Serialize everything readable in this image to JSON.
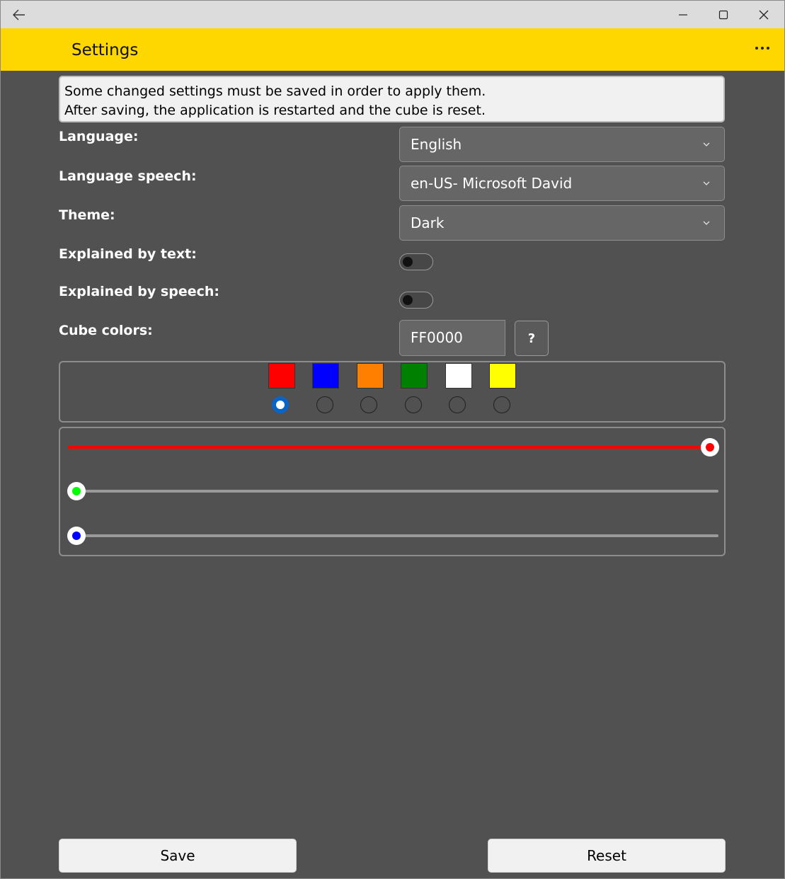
{
  "window": {
    "title": "Settings"
  },
  "info": {
    "line1": "Some changed settings must be saved in order to apply them.",
    "line2": "After saving, the application is restarted and the cube is reset."
  },
  "language": {
    "label": "Language:",
    "value": "English"
  },
  "language_speech": {
    "label": "Language speech:",
    "value": "en-US- Microsoft David"
  },
  "theme": {
    "label": "Theme:",
    "value": "Dark"
  },
  "explained_by_text": {
    "label": "Explained by text:",
    "on": false
  },
  "explained_by_speech": {
    "label": "Explained by speech:",
    "on": false
  },
  "cube_colors": {
    "label": "Cube colors:",
    "hex_value": "FF0000",
    "help_label": "?",
    "swatches": [
      "#ff0000",
      "#0000ff",
      "#ff8000",
      "#008000",
      "#ffffff",
      "#ffff00"
    ],
    "selected_index": 0
  },
  "rgb_sliders": {
    "red": {
      "value": 255,
      "max": 255,
      "color": "#ff0000"
    },
    "green": {
      "value": 0,
      "max": 255,
      "color": "#00ff00"
    },
    "blue": {
      "value": 0,
      "max": 255,
      "color": "#0000ff"
    }
  },
  "buttons": {
    "save": "Save",
    "reset": "Reset"
  }
}
